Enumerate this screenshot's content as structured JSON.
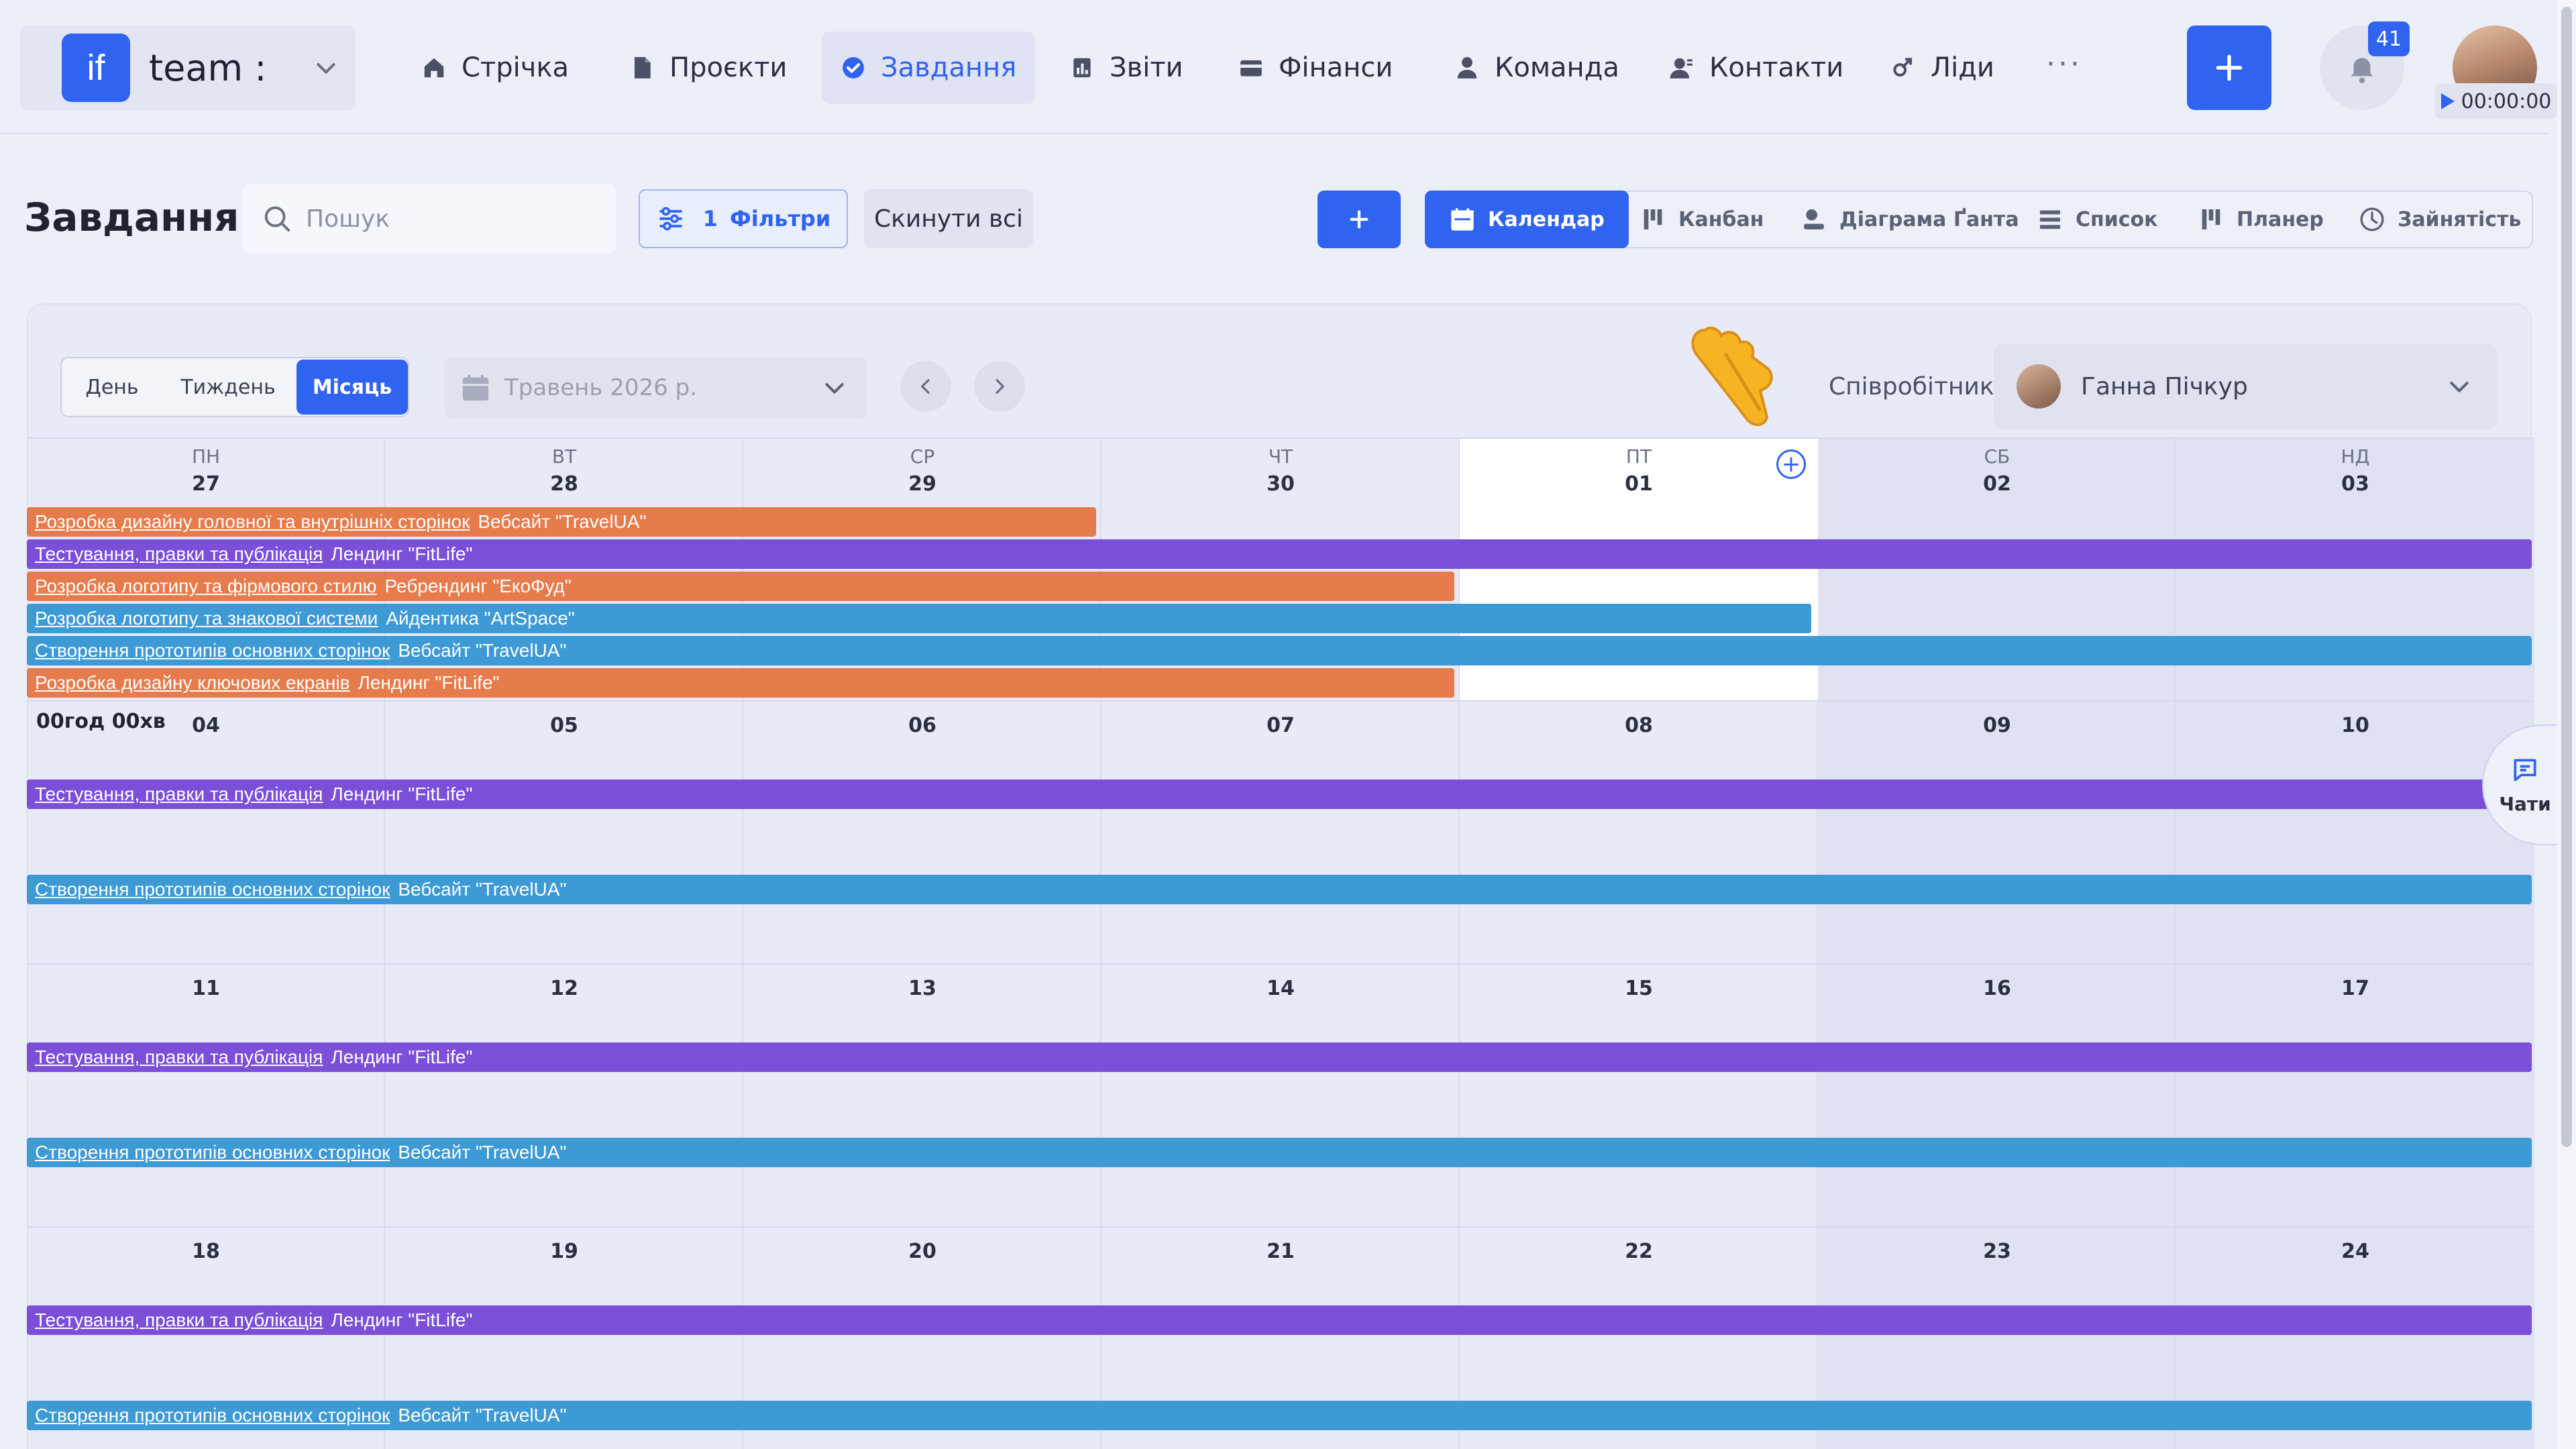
{
  "brand": {
    "logo": "if",
    "name": "team :"
  },
  "nav": [
    {
      "label": "Стрічка",
      "icon": "home-icon"
    },
    {
      "label": "Проєкти",
      "icon": "document-icon"
    },
    {
      "label": "Завдання",
      "icon": "check-circle-icon",
      "active": true
    },
    {
      "label": "Звіти",
      "icon": "report-icon"
    },
    {
      "label": "Фінанси",
      "icon": "wallet-icon"
    },
    {
      "label": "Команда",
      "icon": "person-icon"
    },
    {
      "label": "Контакти",
      "icon": "contacts-icon"
    },
    {
      "label": "Ліди",
      "icon": "leads-icon"
    }
  ],
  "header": {
    "more": "···",
    "notifications_count": "41",
    "timer": "00:00:00"
  },
  "toolbar": {
    "title": "Завдання",
    "search_placeholder": "Пошук",
    "filters_count": "1",
    "filters_label": "Фільтри",
    "reset_label": "Скинути всі",
    "add_label": "+"
  },
  "views": [
    {
      "label": "Календар",
      "icon": "calendar-icon",
      "active": true
    },
    {
      "label": "Канбан",
      "icon": "kanban-icon"
    },
    {
      "label": "Діаграма Ґанта",
      "icon": "gantt-icon"
    },
    {
      "label": "Список",
      "icon": "list-icon"
    },
    {
      "label": "Планер",
      "icon": "planner-icon"
    },
    {
      "label": "Зайнятість",
      "icon": "clock-icon"
    }
  ],
  "calendar": {
    "periods": [
      {
        "label": "День"
      },
      {
        "label": "Тиждень"
      },
      {
        "label": "Місяць",
        "active": true
      }
    ],
    "month": "Травень 2026 р.",
    "employee_label": "Співробітник",
    "employee_name": "Ганна Пічкур",
    "weekdays": [
      "ПН",
      "ВТ",
      "СР",
      "ЧТ",
      "ПТ",
      "СБ",
      "НД"
    ],
    "weeks": [
      [
        "27",
        "28",
        "29",
        "30",
        "01",
        "02",
        "03"
      ],
      [
        "04",
        "05",
        "06",
        "07",
        "08",
        "09",
        "10"
      ],
      [
        "11",
        "12",
        "13",
        "14",
        "15",
        "16",
        "17"
      ],
      [
        "18",
        "19",
        "20",
        "21",
        "22",
        "23",
        "24"
      ]
    ],
    "hours_label": "00год 00хв",
    "tasks": [
      {
        "title": "Розробка дизайну головної та внутрішніх сторінок",
        "project": "Вебсайт \"TravelUA\"",
        "color": "#e67b4c"
      },
      {
        "title": "Тестування, правки та публікація",
        "project": "Лендинг \"FitLife\"",
        "color": "#7b4fd7"
      },
      {
        "title": "Розробка логотипу та фірмового стилю",
        "project": "Ребрендинг \"ЕкоФуд\"",
        "color": "#e67b4c"
      },
      {
        "title": "Розробка логотипу та знакової системи",
        "project": "Айдентика \"ArtSpace\"",
        "color": "#3d9ad5"
      },
      {
        "title": "Створення прототипів основних сторінок",
        "project": "Вебсайт \"TravelUA\"",
        "color": "#3d9ad5"
      },
      {
        "title": "Розробка дизайну ключових екранів",
        "project": "Лендинг \"FitLife\"",
        "color": "#e67b4c"
      }
    ]
  },
  "chats_label": "Чати"
}
